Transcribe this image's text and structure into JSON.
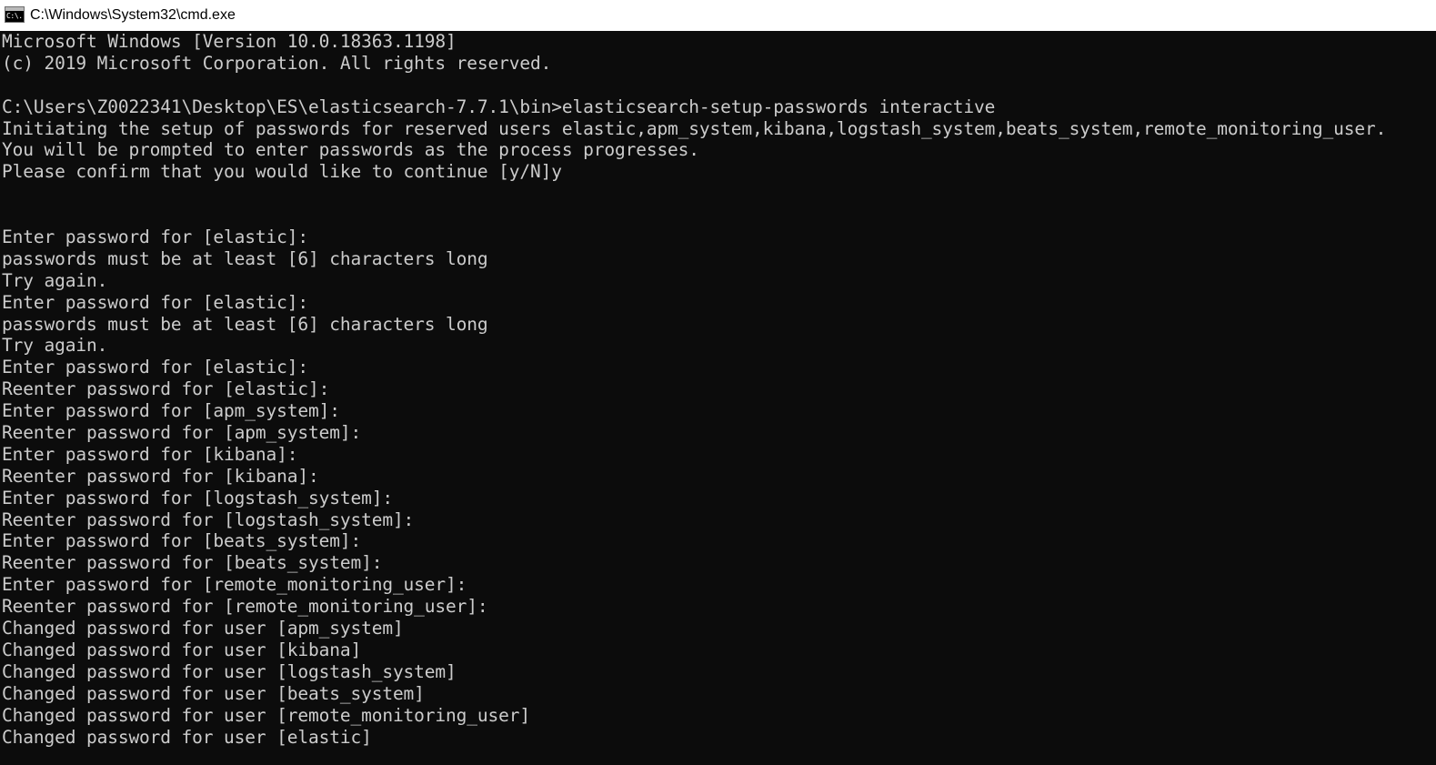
{
  "window": {
    "title": "C:\\Windows\\System32\\cmd.exe",
    "icon_name": "cmd-console-icon",
    "icon_text": "C:\\."
  },
  "colors": {
    "titlebar_background": "#ffffff",
    "console_background": "#0c0c0c",
    "console_text": "#cccccc"
  },
  "console": {
    "lines": [
      "Microsoft Windows [Version 10.0.18363.1198]",
      "(c) 2019 Microsoft Corporation. All rights reserved.",
      "",
      "C:\\Users\\Z0022341\\Desktop\\ES\\elasticsearch-7.7.1\\bin>elasticsearch-setup-passwords interactive",
      "Initiating the setup of passwords for reserved users elastic,apm_system,kibana,logstash_system,beats_system,remote_monitoring_user.",
      "You will be prompted to enter passwords as the process progresses.",
      "Please confirm that you would like to continue [y/N]y",
      "",
      "",
      "Enter password for [elastic]:",
      "passwords must be at least [6] characters long",
      "Try again.",
      "Enter password for [elastic]:",
      "passwords must be at least [6] characters long",
      "Try again.",
      "Enter password for [elastic]:",
      "Reenter password for [elastic]:",
      "Enter password for [apm_system]:",
      "Reenter password for [apm_system]:",
      "Enter password for [kibana]:",
      "Reenter password for [kibana]:",
      "Enter password for [logstash_system]:",
      "Reenter password for [logstash_system]:",
      "Enter password for [beats_system]:",
      "Reenter password for [beats_system]:",
      "Enter password for [remote_monitoring_user]:",
      "Reenter password for [remote_monitoring_user]:",
      "Changed password for user [apm_system]",
      "Changed password for user [kibana]",
      "Changed password for user [logstash_system]",
      "Changed password for user [beats_system]",
      "Changed password for user [remote_monitoring_user]",
      "Changed password for user [elastic]"
    ]
  }
}
